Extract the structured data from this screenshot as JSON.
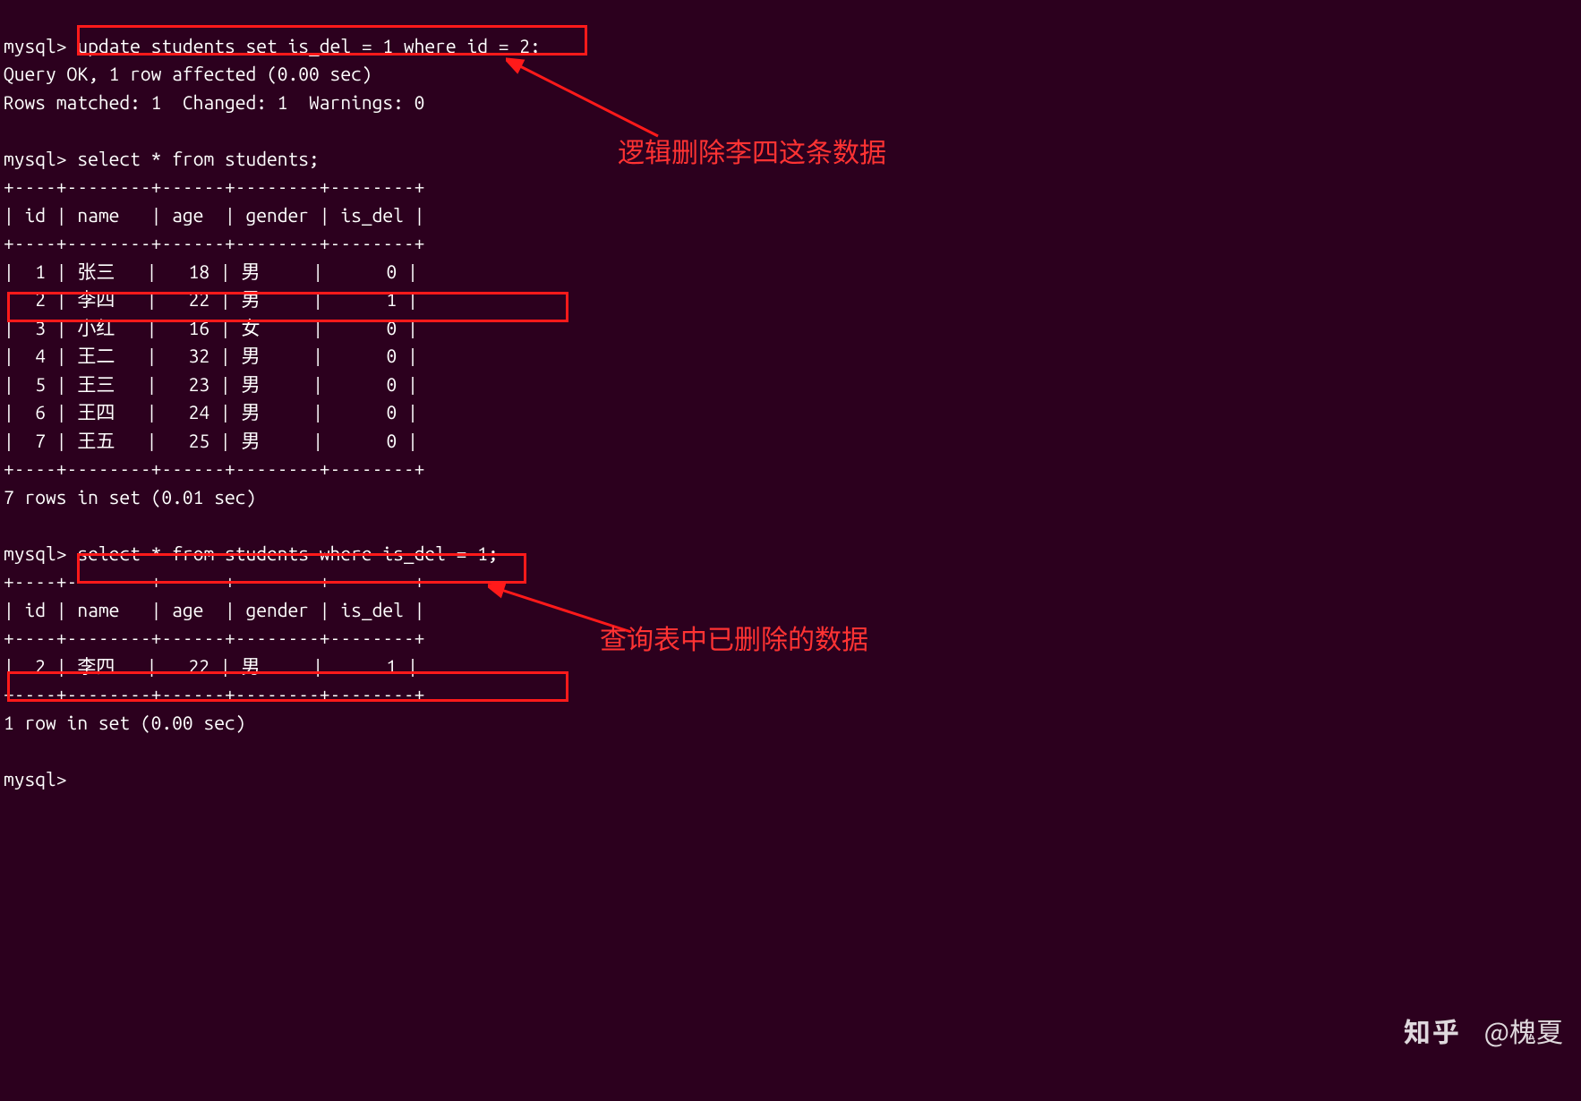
{
  "prompt": "mysql>",
  "cmd_update": "update students set is_del = 1 where id = 2;",
  "res_update_line1": "Query OK, 1 row affected (0.00 sec)",
  "res_update_line2": "Rows matched: 1  Changed: 1  Warnings: 0",
  "cmd_select_all": "select * from students;",
  "table1": {
    "border": "+----+--------+------+--------+--------+",
    "header": "| id | name   | age  | gender | is_del |",
    "rows": [
      "|  1 | 张三   |   18 | 男     |      0 |",
      "|  2 | 李四   |   22 | 男     |      1 |",
      "|  3 | 小红   |   16 | 女     |      0 |",
      "|  4 | 王二   |   32 | 男     |      0 |",
      "|  5 | 王三   |   23 | 男     |      0 |",
      "|  6 | 王四   |   24 | 男     |      0 |",
      "|  7 | 王五   |   25 | 男     |      0 |"
    ],
    "footer": "7 rows in set (0.01 sec)"
  },
  "cmd_select_del": "select * from students where is_del = 1;",
  "table2": {
    "border": "+----+--------+------+--------+--------+",
    "header": "| id | name   | age  | gender | is_del |",
    "rows": [
      "|  2 | 李四   |   22 | 男     |      1 |"
    ],
    "footer": "1 row in set (0.00 sec)"
  },
  "annotations": {
    "logic_delete": "逻辑删除李四这条数据",
    "query_deleted": "查询表中已删除的数据"
  },
  "watermark": {
    "brand": "知乎",
    "handle": "@槐夏"
  },
  "colors": {
    "bg": "#2c001e",
    "fg": "#ffffff",
    "highlight": "#ff1a1a"
  }
}
